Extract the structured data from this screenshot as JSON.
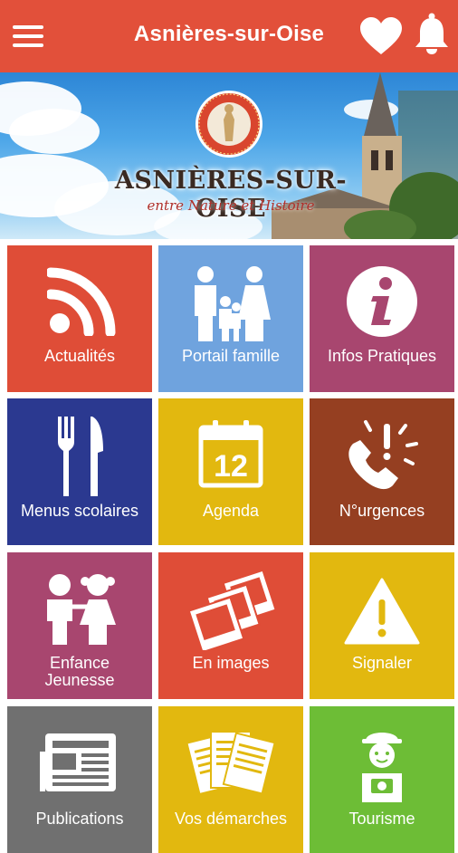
{
  "app": {
    "title": "Asnières-sur-Oise"
  },
  "header": {
    "menu_icon": "hamburger-menu-icon",
    "favorite_icon": "heart-icon",
    "notification_icon": "bell-icon"
  },
  "banner": {
    "town_name": "ASNIÈRES-SUR-OISE",
    "tagline": "entre Nature et Histoire",
    "seal_text": "ASNIÈRES-SUR-OISE"
  },
  "colors": {
    "header": "#e2503a",
    "red": "#df4d37",
    "blue": "#6fa3de",
    "plum": "#a8466f",
    "navy": "#2b3990",
    "yellow": "#e2b80f",
    "brown": "#953f21",
    "gray": "#707070",
    "green": "#6dbd36"
  },
  "tiles": [
    {
      "label": "Actualités",
      "icon": "rss-feed-icon"
    },
    {
      "label": "Portail famille",
      "icon": "family-icon"
    },
    {
      "label": "Infos Pratiques",
      "icon": "info-icon"
    },
    {
      "label": "Menus scolaires",
      "icon": "fork-knife-icon"
    },
    {
      "label": "Agenda",
      "icon": "calendar-icon",
      "day": "12"
    },
    {
      "label": "N°urgences",
      "icon": "emergency-phone-icon"
    },
    {
      "label_line1": "Enfance",
      "label_line2": "Jeunesse",
      "icon": "children-icon"
    },
    {
      "label": "En images",
      "icon": "photos-icon"
    },
    {
      "label": "Signaler",
      "icon": "warning-icon"
    },
    {
      "label": "Publications",
      "icon": "newspaper-icon"
    },
    {
      "label": "Vos démarches",
      "icon": "documents-icon"
    },
    {
      "label": "Tourisme",
      "icon": "tourist-icon"
    }
  ]
}
